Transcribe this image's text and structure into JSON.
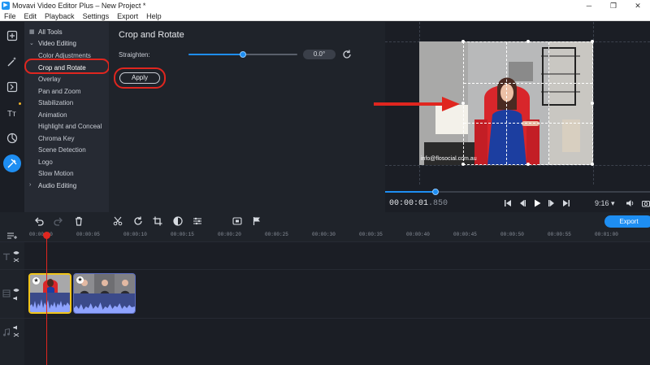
{
  "window": {
    "title": "Movavi Video Editor Plus – New Project *",
    "minimize": "─",
    "maximize": "❐",
    "close": "✕"
  },
  "menu": [
    "File",
    "Edit",
    "Playback",
    "Settings",
    "Export",
    "Help"
  ],
  "tools_panel": {
    "all_tools": "All Tools",
    "video_editing": "Video Editing",
    "items": [
      "Color Adjustments",
      "Crop and Rotate",
      "Overlay",
      "Pan and Zoom",
      "Stabilization",
      "Animation",
      "Highlight and Conceal",
      "Chroma Key",
      "Scene Detection",
      "Logo",
      "Slow Motion"
    ],
    "audio_editing": "Audio Editing",
    "selected": "Crop and Rotate"
  },
  "settings": {
    "title": "Crop and Rotate",
    "straighten_label": "Straighten:",
    "straighten_value": "0.0°",
    "straighten_fraction": 0.5,
    "apply_label": "Apply"
  },
  "preview": {
    "watermark": "info@flosocial.com.au",
    "sign_text": "THE NEW LEF",
    "timecode_main": "00:00:01",
    "timecode_frac": ".850",
    "playback_fraction": 0.19,
    "aspect_ratio": "9:16 ▾"
  },
  "timeline": {
    "export_label": "Export",
    "ticks": [
      "00:00:00",
      "00:00:05",
      "00:00:10",
      "00:00:15",
      "00:00:20",
      "00:00:25",
      "00:00:30",
      "00:00:35",
      "00:00:40",
      "00:00:45",
      "00:00:50",
      "00:00:55",
      "00:01:00",
      "00:01:05"
    ]
  },
  "colors": {
    "accent": "#1e8ef2",
    "annotation_red": "#e0261f",
    "selected_clip": "#f0c419"
  }
}
